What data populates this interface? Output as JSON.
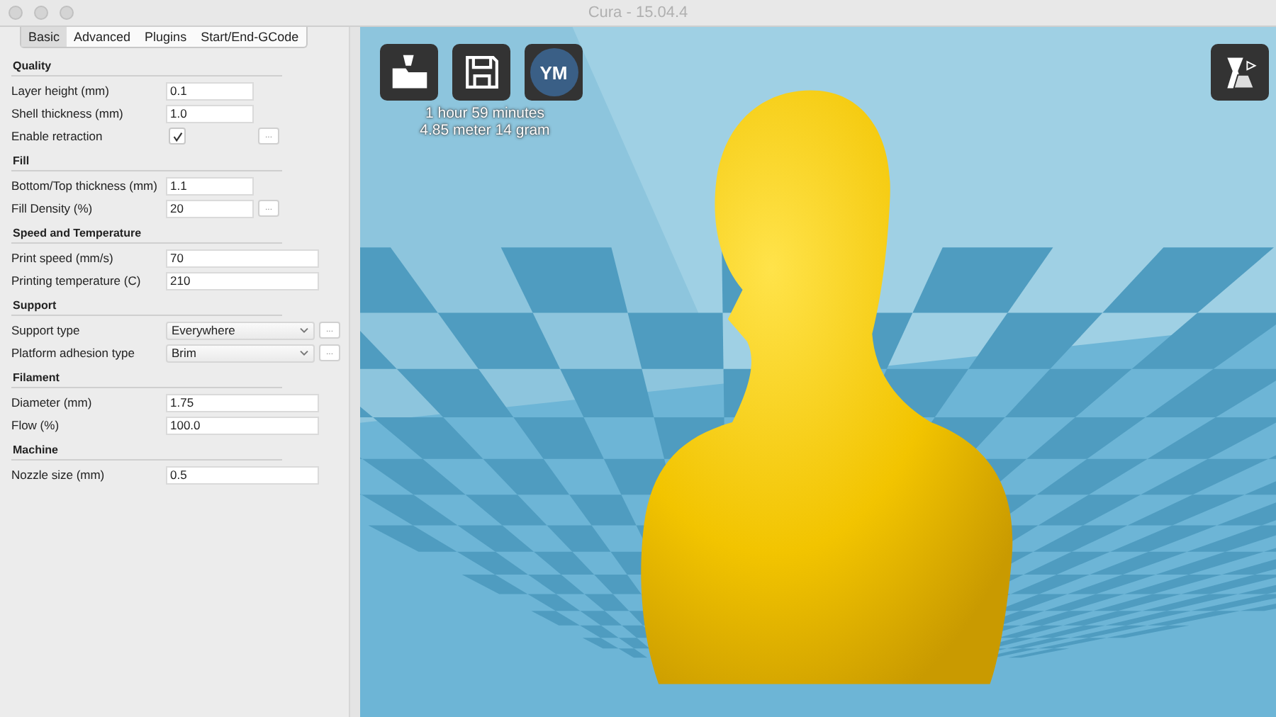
{
  "window": {
    "title": "Cura - 15.04.4"
  },
  "tabs": [
    {
      "label": "Basic",
      "selected": true
    },
    {
      "label": "Advanced",
      "selected": false
    },
    {
      "label": "Plugins",
      "selected": false
    },
    {
      "label": "Start/End-GCode",
      "selected": false
    }
  ],
  "sections": [
    {
      "title": "Quality",
      "rows": [
        {
          "kind": "text",
          "label": "Layer height (mm)",
          "value": "0.1"
        },
        {
          "kind": "text",
          "label": "Shell thickness (mm)",
          "value": "1.0"
        },
        {
          "kind": "checkbox",
          "label": "Enable retraction",
          "checked": true,
          "more": "..."
        }
      ]
    },
    {
      "title": "Fill",
      "rows": [
        {
          "kind": "text",
          "label": "Bottom/Top thickness (mm)",
          "value": "1.1"
        },
        {
          "kind": "text",
          "label": "Fill Density (%)",
          "value": "20",
          "more": "..."
        }
      ]
    },
    {
      "title": "Speed and Temperature",
      "rows": [
        {
          "kind": "text",
          "label": "Print speed (mm/s)",
          "value": "70"
        },
        {
          "kind": "text",
          "label": "Printing temperature (C)",
          "value": "210"
        }
      ]
    },
    {
      "title": "Support",
      "rows": [
        {
          "kind": "select",
          "label": "Support type",
          "value": "Everywhere",
          "more": "..."
        },
        {
          "kind": "select",
          "label": "Platform adhesion type",
          "value": "Brim",
          "more": "..."
        }
      ]
    },
    {
      "title": "Filament",
      "rows": [
        {
          "kind": "text",
          "label": "Diameter (mm)",
          "value": "1.75"
        },
        {
          "kind": "text",
          "label": "Flow (%)",
          "value": "100.0"
        }
      ]
    },
    {
      "title": "Machine",
      "rows": [
        {
          "kind": "text",
          "label": "Nozzle size (mm)",
          "value": "0.5"
        }
      ]
    }
  ],
  "viewport": {
    "toolbar_badge": "YM",
    "print_time": "1 hour 59 minutes",
    "material": "4.85 meter 14 gram"
  }
}
